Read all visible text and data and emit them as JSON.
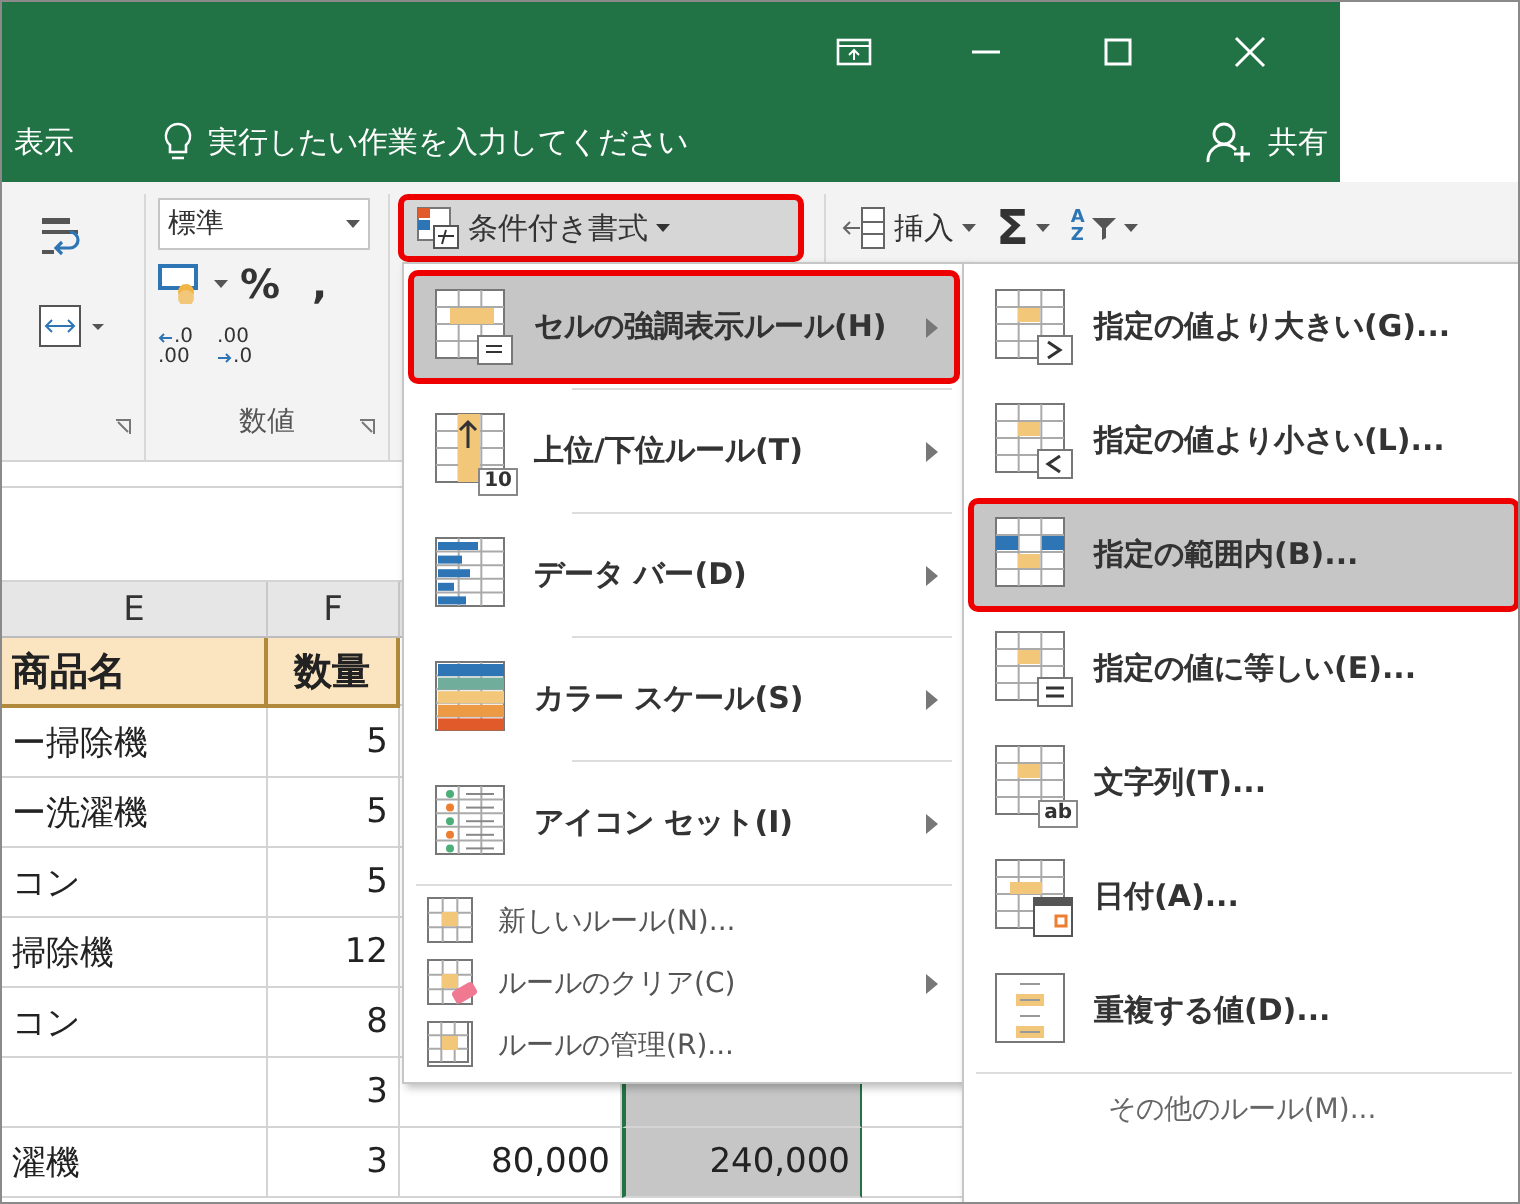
{
  "tell_me_bar": {
    "tab": "表示",
    "search_placeholder": "実行したい作業を入力してください",
    "share": "共有"
  },
  "ribbon": {
    "number_format": "標準",
    "percent": "%",
    "comma": ",",
    "decimal_increase": {
      "top": ".0",
      "bottom": ".00"
    },
    "decimal_decrease": {
      "top": ".00",
      "bottom": ".0"
    },
    "number_group_label": "数値",
    "conditional_formatting": {
      "label": "条件付き書式",
      "highlighted": true
    },
    "insert": "挿入",
    "sum": "Σ",
    "sort_letters": {
      "top": "A",
      "bottom": "Z"
    }
  },
  "sheet": {
    "columns": [
      {
        "label": "E",
        "selected": false
      },
      {
        "label": "F",
        "selected": false
      },
      {
        "selected": false
      },
      {
        "selected": true
      }
    ],
    "header_row": [
      "商品名",
      "数量"
    ],
    "rows": [
      {
        "cells": [
          "ー掃除機",
          "5"
        ]
      },
      {
        "cells": [
          "ー洗濯機",
          "5"
        ]
      },
      {
        "cells": [
          "コン",
          "5"
        ]
      },
      {
        "cells": [
          "掃除機",
          "12"
        ]
      },
      {
        "cells": [
          "コン",
          "8"
        ]
      },
      {
        "cells": [
          "",
          "3"
        ]
      },
      {
        "cells": [
          "濯機",
          "3",
          "80,000",
          "240,000"
        ]
      }
    ]
  },
  "menu": {
    "items": [
      {
        "kind": "large",
        "label": "セルの強調表示ルール(H)",
        "submenu": true,
        "selected": true,
        "highlighted": true
      },
      {
        "kind": "large",
        "label": "上位/下位ルール(T)",
        "submenu": true,
        "selected": false,
        "highlighted": false,
        "badge": "10"
      },
      {
        "kind": "large",
        "label": "データ バー(D)",
        "submenu": true,
        "selected": false,
        "highlighted": false
      },
      {
        "kind": "large",
        "label": "カラー スケール(S)",
        "submenu": true,
        "selected": false,
        "highlighted": false
      },
      {
        "kind": "large",
        "label": "アイコン セット(I)",
        "submenu": true,
        "selected": false,
        "highlighted": false
      },
      {
        "kind": "small",
        "label": "新しいルール(N)...",
        "submenu": false,
        "selected": false,
        "highlighted": false
      },
      {
        "kind": "small",
        "label": "ルールのクリア(C)",
        "submenu": true,
        "selected": false,
        "highlighted": false
      },
      {
        "kind": "small",
        "label": "ルールの管理(R)...",
        "submenu": false,
        "selected": false,
        "highlighted": false
      }
    ]
  },
  "submenu": {
    "items": [
      {
        "kind": "large",
        "label": "指定の値より大きい(G)...",
        "selected": false,
        "highlighted": false
      },
      {
        "kind": "large",
        "label": "指定の値より小さい(L)...",
        "selected": false,
        "highlighted": false
      },
      {
        "kind": "large",
        "label": "指定の範囲内(B)...",
        "selected": true,
        "highlighted": true
      },
      {
        "kind": "large",
        "label": "指定の値に等しい(E)...",
        "selected": false,
        "highlighted": false
      },
      {
        "kind": "large",
        "label": "文字列(T)...",
        "selected": false,
        "highlighted": false,
        "badge": "ab"
      },
      {
        "kind": "large",
        "label": "日付(A)...",
        "selected": false,
        "highlighted": false
      },
      {
        "kind": "large",
        "label": "重複する値(D)...",
        "selected": false,
        "highlighted": false
      },
      {
        "kind": "small",
        "label": "その他のルール(M)...",
        "selected": false,
        "highlighted": false
      }
    ]
  }
}
